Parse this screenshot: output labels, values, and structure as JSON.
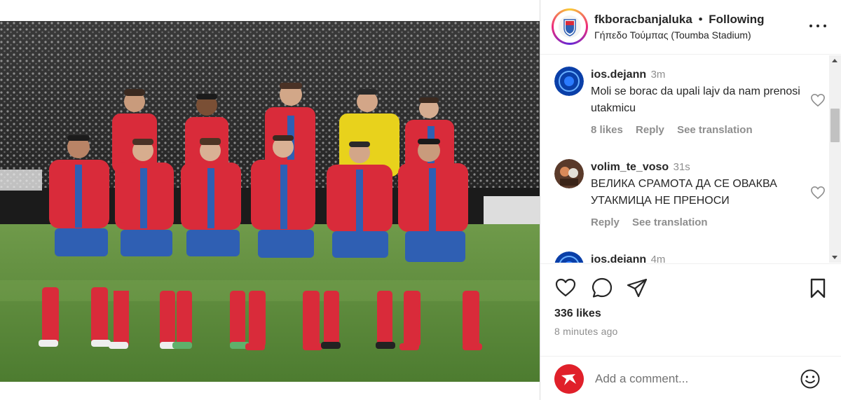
{
  "post": {
    "username": "fkboracbanjaluka",
    "separator": "•",
    "follow_state": "Following",
    "location": "Γήπεδο Τούμπας (Toumba Stadium)"
  },
  "comments": [
    {
      "username": "ios.dejann",
      "time": "3m",
      "text": "Moli se borac da upali lajv da nam prenosi utakmicu",
      "likes": "8 likes",
      "reply": "Reply",
      "translate": "See translation"
    },
    {
      "username": "volim_te_voso",
      "time": "31s",
      "text": "ВЕЛИКА СРАМОТА ДА СЕ ОВАКВА УТАКМИЦА НЕ ПРЕНОСИ",
      "reply": "Reply",
      "translate": "See translation"
    },
    {
      "username": "ios.dejann",
      "time": "4m"
    }
  ],
  "engagement": {
    "likes": "336 likes",
    "posted": "8 minutes ago"
  },
  "composer": {
    "placeholder": "Add a comment..."
  },
  "icons": {
    "like": "heart-icon",
    "comment": "comment-bubble-icon",
    "share": "paper-plane-icon",
    "save": "bookmark-icon",
    "more": "more-options-icon",
    "emoji": "emoji-smiley-icon"
  },
  "colors": {
    "kit_red": "#d92b3a",
    "kit_blue": "#2f5fb3",
    "keeper_yellow": "#e8d21c",
    "pitch": "#5a8a3a",
    "avatar_red": "#e0202a"
  }
}
